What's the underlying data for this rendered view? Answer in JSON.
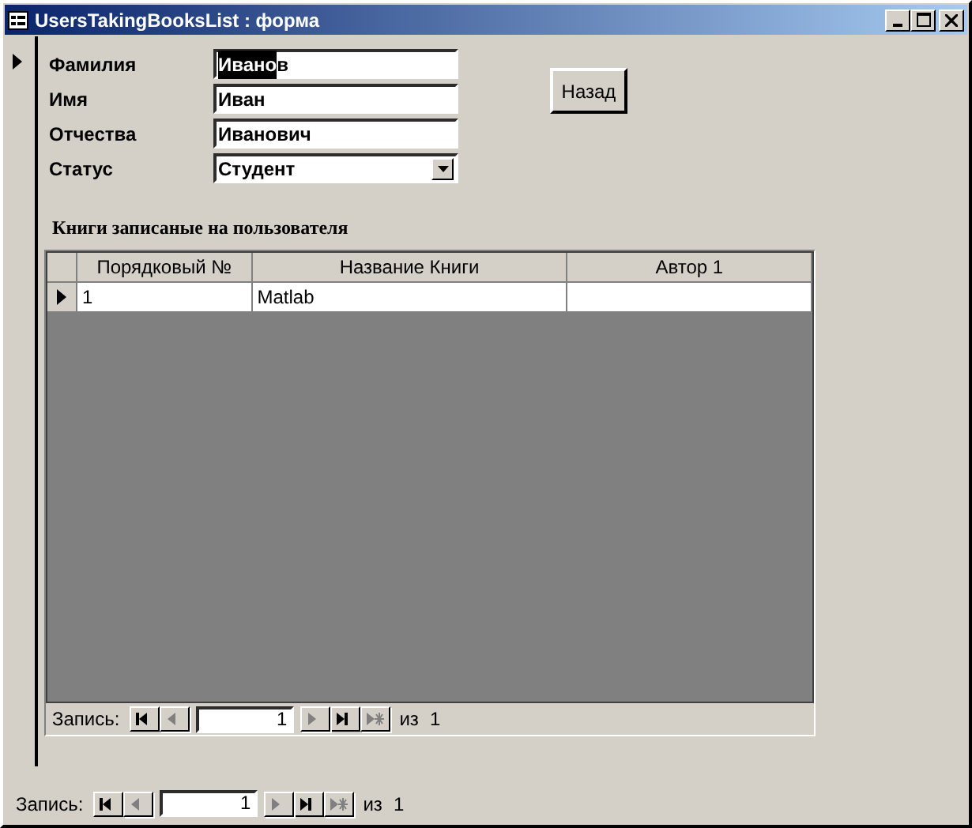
{
  "window": {
    "title": "UsersTakingBooksList : форма"
  },
  "form": {
    "current_record": true,
    "fields": [
      {
        "label": "Фамилия",
        "kind": "text",
        "value_parts": [
          {
            "text": "Ивано",
            "selected": true
          },
          {
            "text": "в",
            "selected": false
          }
        ]
      },
      {
        "label": "Имя",
        "kind": "text",
        "value_parts": [
          {
            "text": "Иван",
            "selected": false
          }
        ]
      },
      {
        "label": "Отчества",
        "kind": "text",
        "value_parts": [
          {
            "text": "Иванович",
            "selected": false
          }
        ]
      },
      {
        "label": "Статус",
        "kind": "combo",
        "value_parts": [
          {
            "text": "Студент",
            "selected": false
          }
        ]
      }
    ],
    "back_button": "Назад"
  },
  "subform": {
    "caption": "Книги записаные на пользователя",
    "columns": [
      "Порядковый №",
      "Название Книги",
      "Автор 1"
    ],
    "rows": [
      {
        "current": true,
        "cells": [
          "1",
          "Matlab"
        ]
      }
    ],
    "navigator": {
      "label": "Запись:",
      "record": "1",
      "of": "из",
      "total": "1",
      "buttons": [
        {
          "kind": "first",
          "disabled": false
        },
        {
          "kind": "prev",
          "disabled": true
        },
        {
          "kind": "next",
          "disabled": true
        },
        {
          "kind": "last",
          "disabled": false
        },
        {
          "kind": "new",
          "disabled": true
        }
      ]
    }
  },
  "navigator": {
    "label": "Запись:",
    "record": "1",
    "of": "из",
    "total": "1",
    "buttons": [
      {
        "kind": "first",
        "disabled": false
      },
      {
        "kind": "prev",
        "disabled": true
      },
      {
        "kind": "next",
        "disabled": true
      },
      {
        "kind": "last",
        "disabled": false
      },
      {
        "kind": "new",
        "disabled": true
      }
    ]
  }
}
